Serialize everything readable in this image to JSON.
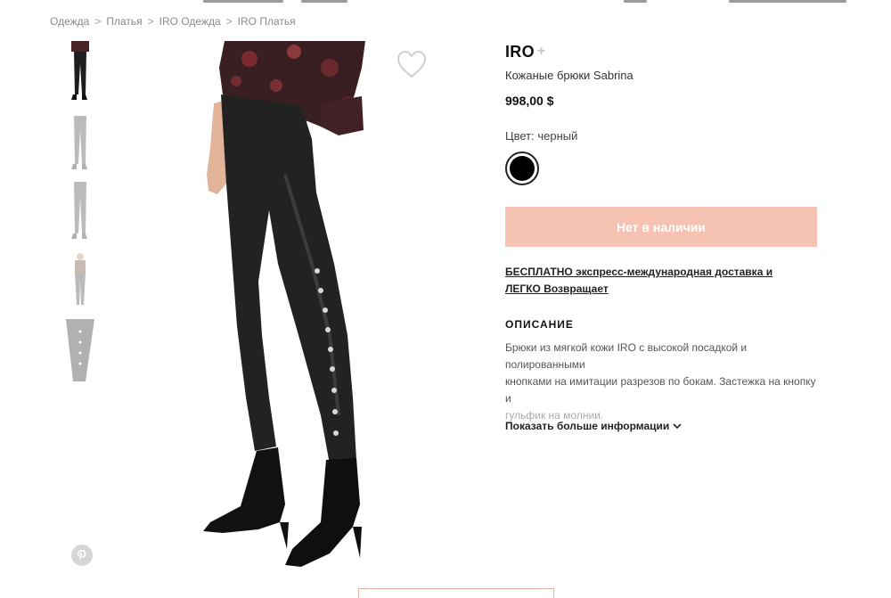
{
  "breadcrumb": {
    "items": [
      "Одежда",
      "Платья",
      "IRO Одежда",
      "IRO Платья"
    ],
    "separator": ">"
  },
  "product": {
    "brand": "IRO",
    "brand_plus": "+",
    "name": "Кожаные брюки Sabrina",
    "price": "998,00 $",
    "color_label": "Цвет: черный",
    "selected_color": "#000000",
    "availability_button": "Нет в наличии",
    "shipping_text": "БЕСПЛАТНО экспресс-международная доставка и ЛЕГКО Возвращает",
    "description_title": "ОПИСАНИЕ",
    "description_lines": [
      "Брюки из мягкой кожи IRO с высокой посадкой и полированными",
      "кнопками на имитации разрезов по бокам. Застежка на кнопку и",
      "гульфик на молнии."
    ],
    "more_info_label": "Показать больше информации"
  },
  "icons": {
    "wishlist": "heart-outline-icon",
    "pinterest": "pinterest-icon",
    "more_info": "chevron-down-icon"
  },
  "colors": {
    "oos_button_bg": "#f6c3b3",
    "swatch": "#000000"
  }
}
